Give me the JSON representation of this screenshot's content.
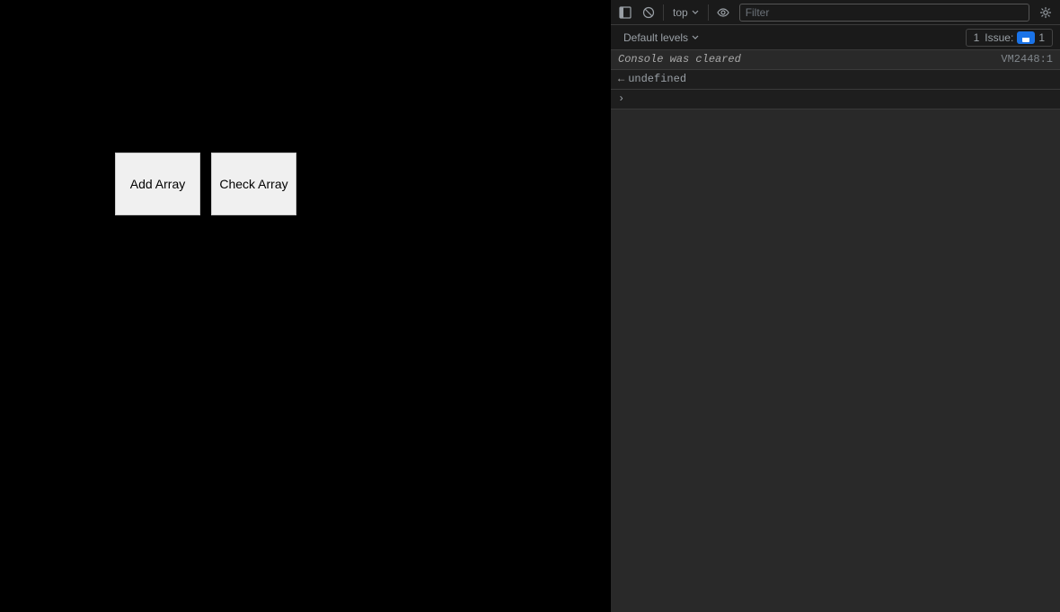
{
  "browser": {
    "buttons": [
      {
        "id": "add-array",
        "label": "Add Array"
      },
      {
        "id": "check-array",
        "label": "Check Array"
      }
    ]
  },
  "devtools": {
    "toolbar": {
      "toggle_label": "⊡",
      "block_label": "🚫",
      "top_label": "top",
      "eye_label": "👁",
      "filter_placeholder": "Filter",
      "settings_label": "⚙"
    },
    "toolbar2": {
      "default_levels_label": "Default levels",
      "issues_count": "1",
      "issues_label": "Issue:",
      "issues_badge_num": "1"
    },
    "console": {
      "cleared_text": "Console was cleared",
      "cleared_link": "VM2448:1",
      "undefined_arrow": "←",
      "undefined_text": "undefined",
      "expand_arrow": "›"
    }
  }
}
